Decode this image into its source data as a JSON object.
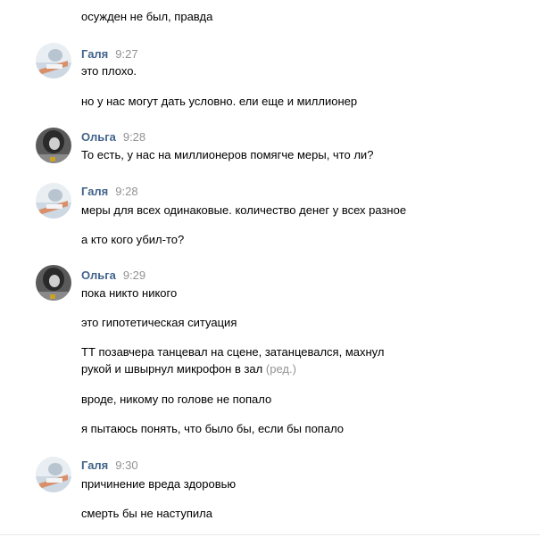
{
  "messages": [
    {
      "text": "осужден не был, правда"
    },
    {
      "author": "Галя",
      "time": "9:27",
      "avatar": "galya-avatar",
      "lines": [
        "это плохо.",
        "но у нас могут дать условно. ели еще и миллионер"
      ]
    },
    {
      "author": "Ольга",
      "time": "9:28",
      "avatar": "olga-avatar",
      "lines": [
        "То есть, у нас на миллионеров помягче меры, что ли?"
      ]
    },
    {
      "author": "Галя",
      "time": "9:28",
      "avatar": "galya-avatar",
      "lines": [
        "меры для всех одинаковые. количество денег у всех разное",
        "а кто кого убил-то?"
      ]
    },
    {
      "author": "Ольга",
      "time": "9:29",
      "avatar": "olga-avatar",
      "lines": [
        "пока никто никого",
        "это гипотетическая ситуация",
        "ТТ позавчера танцевал на сцене, затанцевался, махнул",
        "рукой и швырнул микрофон в зал",
        "вроде, никому по голове не попало",
        "я пытаюсь понять, что было бы, если бы попало"
      ],
      "edited_label": "(ред.)"
    },
    {
      "author": "Галя",
      "time": "9:30",
      "avatar": "galya-avatar",
      "lines": [
        "причинение вреда здоровью",
        "смерть бы не наступила"
      ]
    }
  ],
  "colors": {
    "author": "#42648b",
    "time": "#939393",
    "text": "#000000",
    "edited": "#939393"
  }
}
